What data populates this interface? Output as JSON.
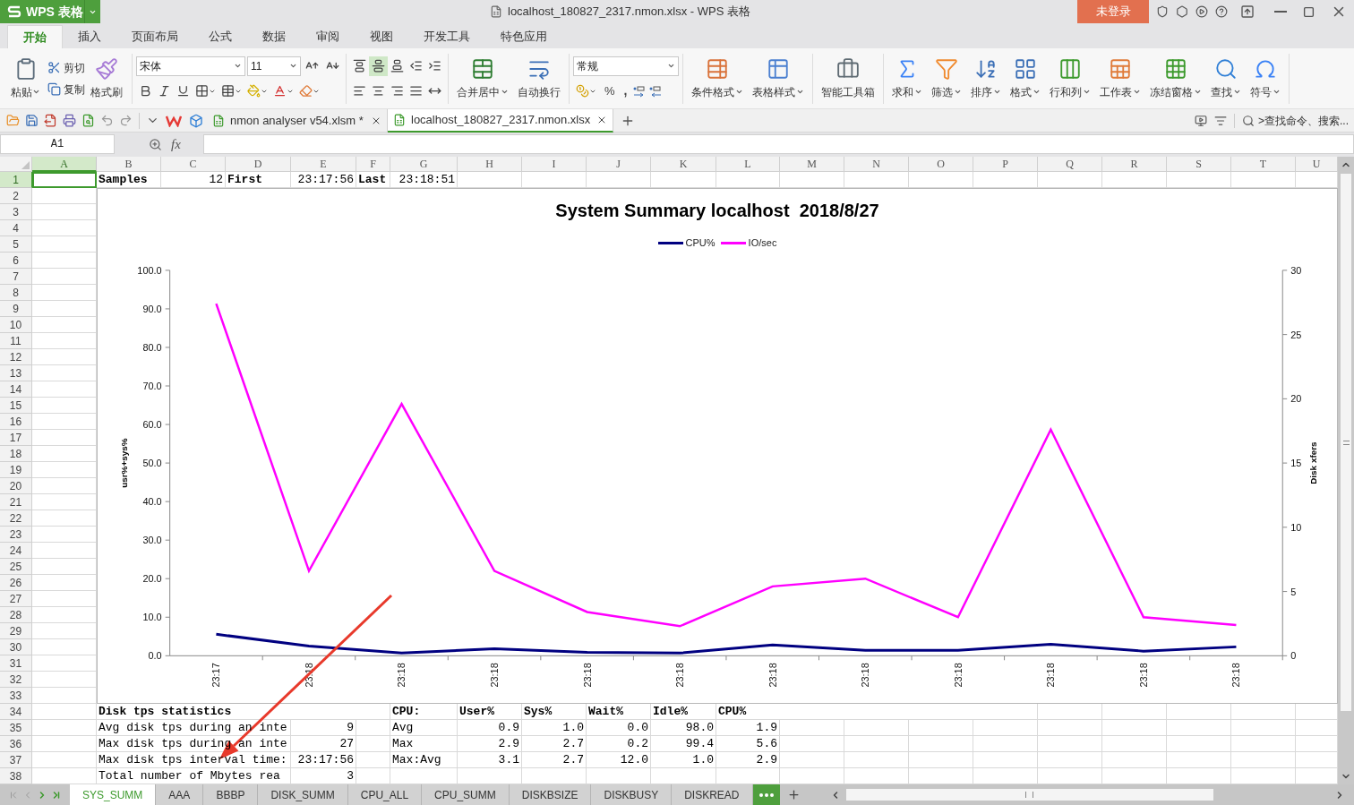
{
  "app_button": {
    "label": "WPS 表格"
  },
  "window_title": "localhost_180827_2317.nmon.xlsx - WPS 表格",
  "login_button": "未登录",
  "menu_tabs": [
    {
      "label": "开始",
      "selected": true
    },
    {
      "label": "插入",
      "selected": false
    },
    {
      "label": "页面布局",
      "selected": false
    },
    {
      "label": "公式",
      "selected": false
    },
    {
      "label": "数据",
      "selected": false
    },
    {
      "label": "审阅",
      "selected": false
    },
    {
      "label": "视图",
      "selected": false
    },
    {
      "label": "开发工具",
      "selected": false
    },
    {
      "label": "特色应用",
      "selected": false
    }
  ],
  "ribbon": {
    "clipboard": {
      "paste": "粘贴",
      "cut": "剪切",
      "copy": "复制",
      "format_painter": "格式刷"
    },
    "font": {
      "name": "宋体",
      "size": "11"
    },
    "vertical_align": [
      {
        "selected": false
      },
      {
        "selected": true
      },
      {
        "selected": false
      }
    ],
    "horizontal_align": [
      {
        "selected": false
      },
      {
        "selected": false
      },
      {
        "selected": false
      },
      {
        "selected": false
      },
      {
        "selected": false
      }
    ],
    "merge_group": [
      {
        "kind": "merge",
        "label": "合并居中",
        "dropdown": true
      },
      {
        "kind": "wrap",
        "label": "自动换行",
        "dropdown": false
      }
    ],
    "number": {
      "format": "常规",
      "percent": "%",
      "comma": ","
    },
    "tool_groups": [
      [
        {
          "kind": "conditional",
          "label": "条件格式",
          "dropdown": true
        },
        {
          "kind": "table-style",
          "label": "表格样式",
          "dropdown": true
        }
      ],
      [
        {
          "kind": "toolbox",
          "label": "智能工具箱",
          "dropdown": false
        }
      ],
      [
        {
          "kind": "sum",
          "label": "求和",
          "dropdown": true
        },
        {
          "kind": "filter",
          "label": "筛选",
          "dropdown": true
        },
        {
          "kind": "sort",
          "label": "排序",
          "dropdown": true
        },
        {
          "kind": "format",
          "label": "格式",
          "dropdown": true
        },
        {
          "kind": "rowcol",
          "label": "行和列",
          "dropdown": true
        },
        {
          "kind": "sheet",
          "label": "工作表",
          "dropdown": true
        },
        {
          "kind": "freeze",
          "label": "冻结窗格",
          "dropdown": true
        },
        {
          "kind": "find",
          "label": "查找",
          "dropdown": true
        },
        {
          "kind": "symbol",
          "label": "符号",
          "dropdown": true
        }
      ]
    ]
  },
  "doc_tabs": [
    {
      "label": "nmon analyser v54.xlsm *",
      "selected": false
    },
    {
      "label": "localhost_180827_2317.nmon.xlsx",
      "selected": true
    }
  ],
  "command_search": ">查找命令、搜索...",
  "formula_bar": {
    "name_box": "A1",
    "fx": "fx"
  },
  "sheet": {
    "columns": [
      {
        "label": "A",
        "selected": true
      },
      {
        "label": "B",
        "selected": false
      },
      {
        "label": "C",
        "selected": false
      },
      {
        "label": "D",
        "selected": false
      },
      {
        "label": "E",
        "selected": false
      },
      {
        "label": "F",
        "selected": false
      },
      {
        "label": "G",
        "selected": false
      },
      {
        "label": "H",
        "selected": false
      },
      {
        "label": "I",
        "selected": false
      },
      {
        "label": "J",
        "selected": false
      },
      {
        "label": "K",
        "selected": false
      },
      {
        "label": "L",
        "selected": false
      },
      {
        "label": "M",
        "selected": false
      },
      {
        "label": "N",
        "selected": false
      },
      {
        "label": "O",
        "selected": false
      },
      {
        "label": "P",
        "selected": false
      },
      {
        "label": "Q",
        "selected": false
      },
      {
        "label": "R",
        "selected": false
      },
      {
        "label": "S",
        "selected": false
      },
      {
        "label": "T",
        "selected": false
      },
      {
        "label": "U",
        "selected": false
      }
    ],
    "rows": [
      {
        "label": "1",
        "selected": true,
        "cells": {
          "B": {
            "text": "Samples",
            "bold": true
          },
          "C": {
            "text": "12",
            "right_aligned": true
          },
          "D": {
            "text": "First",
            "bold": true
          },
          "E": {
            "text": "23:17:56",
            "right_aligned": true
          },
          "F": {
            "text": "Last",
            "bold": true
          },
          "G": {
            "text": "23:18:51",
            "right_aligned": true
          }
        }
      },
      {
        "label": "2",
        "selected": false
      },
      {
        "label": "3",
        "selected": false
      },
      {
        "label": "4",
        "selected": false
      },
      {
        "label": "5",
        "selected": false
      },
      {
        "label": "6",
        "selected": false
      },
      {
        "label": "7",
        "selected": false
      },
      {
        "label": "8",
        "selected": false
      },
      {
        "label": "9",
        "selected": false
      },
      {
        "label": "10",
        "selected": false
      },
      {
        "label": "11",
        "selected": false
      },
      {
        "label": "12",
        "selected": false
      },
      {
        "label": "13",
        "selected": false
      },
      {
        "label": "14",
        "selected": false
      },
      {
        "label": "15",
        "selected": false
      },
      {
        "label": "16",
        "selected": false
      },
      {
        "label": "17",
        "selected": false
      },
      {
        "label": "18",
        "selected": false
      },
      {
        "label": "19",
        "selected": false
      },
      {
        "label": "20",
        "selected": false
      },
      {
        "label": "21",
        "selected": false
      },
      {
        "label": "22",
        "selected": false
      },
      {
        "label": "23",
        "selected": false
      },
      {
        "label": "24",
        "selected": false
      },
      {
        "label": "25",
        "selected": false
      },
      {
        "label": "26",
        "selected": false
      },
      {
        "label": "27",
        "selected": false
      },
      {
        "label": "28",
        "selected": false
      },
      {
        "label": "29",
        "selected": false
      },
      {
        "label": "30",
        "selected": false
      },
      {
        "label": "31",
        "selected": false
      },
      {
        "label": "32",
        "selected": false
      },
      {
        "label": "33",
        "selected": false
      },
      {
        "label": "34",
        "selected": false,
        "cells": {
          "B": {
            "text": "Disk tps statistics",
            "bold": true
          },
          "G": {
            "text": "CPU:",
            "bold": true
          },
          "H": {
            "text": "User%",
            "bold": true
          },
          "I": {
            "text": "Sys%",
            "bold": true
          },
          "J": {
            "text": "Wait%",
            "bold": true
          },
          "K": {
            "text": "Idle%",
            "bold": true
          },
          "L": {
            "text": "CPU%",
            "bold": true
          }
        }
      },
      {
        "label": "35",
        "selected": false,
        "cells": {
          "B": {
            "text": "Avg disk tps during an inte"
          },
          "E": {
            "text": "9",
            "right_aligned": true
          },
          "G": {
            "text": "Avg"
          },
          "H": {
            "text": "0.9",
            "right_aligned": true
          },
          "I": {
            "text": "1.0",
            "right_aligned": true
          },
          "J": {
            "text": "0.0",
            "right_aligned": true
          },
          "K": {
            "text": "98.0",
            "right_aligned": true
          },
          "L": {
            "text": "1.9",
            "right_aligned": true
          }
        }
      },
      {
        "label": "36",
        "selected": false,
        "cells": {
          "B": {
            "text": "Max disk tps during an inte"
          },
          "E": {
            "text": "27",
            "right_aligned": true
          },
          "G": {
            "text": "Max"
          },
          "H": {
            "text": "2.9",
            "right_aligned": true
          },
          "I": {
            "text": "2.7",
            "right_aligned": true
          },
          "J": {
            "text": "0.2",
            "right_aligned": true
          },
          "K": {
            "text": "99.4",
            "right_aligned": true
          },
          "L": {
            "text": "5.6",
            "right_aligned": true
          }
        }
      },
      {
        "label": "37",
        "selected": false,
        "cells": {
          "B": {
            "text": "Max disk tps interval time:"
          },
          "E": {
            "text": "23:17:56",
            "right_aligned": true
          },
          "G": {
            "text": "Max:Avg"
          },
          "H": {
            "text": "3.1",
            "right_aligned": true
          },
          "I": {
            "text": "2.7",
            "right_aligned": true
          },
          "J": {
            "text": "12.0",
            "right_aligned": true
          },
          "K": {
            "text": "1.0",
            "right_aligned": true
          },
          "L": {
            "text": "2.9",
            "right_aligned": true
          }
        }
      },
      {
        "label": "38",
        "selected": false,
        "cells": {
          "B": {
            "text": "Total number of Mbytes rea"
          },
          "E": {
            "text": "3",
            "right_aligned": true
          }
        }
      }
    ],
    "chart": {
      "chart_data": {
        "type": "line",
        "title": "System Summary localhost  2018/8/27",
        "legend": true,
        "categories": [
          "23:17",
          "23:18",
          "23:18",
          "23:18",
          "23:18",
          "23:18",
          "23:18",
          "23:18",
          "23:18",
          "23:18",
          "23:18",
          "23:18"
        ],
        "ylabel": "usr%+sys%",
        "ylim": [
          0,
          100
        ],
        "yticks": [
          {
            "value": 0,
            "label": "0.0"
          },
          {
            "value": 10,
            "label": "10.0"
          },
          {
            "value": 20,
            "label": "20.0"
          },
          {
            "value": 30,
            "label": "30.0"
          },
          {
            "value": 40,
            "label": "40.0"
          },
          {
            "value": 50,
            "label": "50.0"
          },
          {
            "value": 60,
            "label": "60.0"
          },
          {
            "value": 70,
            "label": "70.0"
          },
          {
            "value": 80,
            "label": "80.0"
          },
          {
            "value": 90,
            "label": "90.0"
          },
          {
            "value": 100,
            "label": "100.0"
          }
        ],
        "y2label": "Disk xfers",
        "y2lim": [
          0,
          30
        ],
        "y2ticks": [
          0,
          5,
          10,
          15,
          20,
          25,
          30
        ],
        "series": [
          {
            "name": "CPU%",
            "color": "#000080",
            "values": [
              5.6,
              2.5,
              0.7,
              1.8,
              0.9,
              0.7,
              2.8,
              1.4,
              1.4,
              3.0,
              1.2,
              2.3
            ]
          },
          {
            "name": "IO/sec",
            "color": "#ff00ff",
            "axis": "y2",
            "values": [
              27.4,
              6.6,
              19.6,
              6.6,
              3.4,
              2.3,
              5.4,
              6.0,
              3.0,
              17.6,
              3.0,
              2.4
            ]
          }
        ]
      }
    }
  },
  "sheet_tabs": [
    {
      "label": "SYS_SUMM",
      "selected": true
    },
    {
      "label": "AAA",
      "selected": false
    },
    {
      "label": "BBBP",
      "selected": false
    },
    {
      "label": "DISK_SUMM",
      "selected": false
    },
    {
      "label": "CPU_ALL",
      "selected": false
    },
    {
      "label": "CPU_SUMM",
      "selected": false
    },
    {
      "label": "DISKBSIZE",
      "selected": false
    },
    {
      "label": "DISKBUSY",
      "selected": false
    },
    {
      "label": "DISKREAD",
      "selected": false
    }
  ]
}
